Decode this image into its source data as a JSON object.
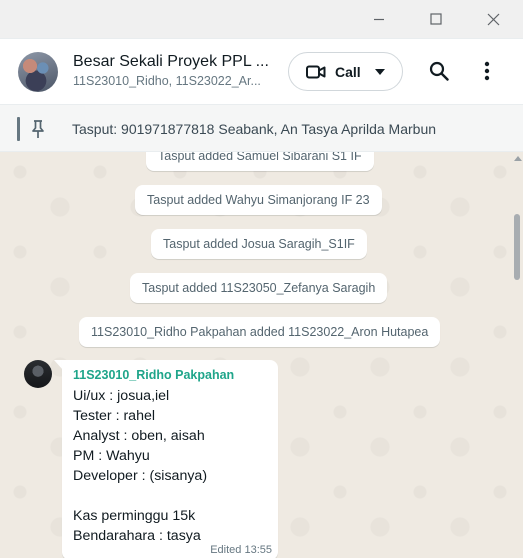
{
  "header": {
    "title": "Besar Sekali Proyek PPL ...",
    "subtitle": "11S23010_Ridho, 11S23022_Ar...",
    "call_label": "Call"
  },
  "pinned": {
    "sender": "Tasput",
    "text": ": 901971877818 Seabank, An Tasya Aprilda Marbun"
  },
  "system_messages": [
    "Tasput added Samuel Sibarani S1 IF",
    "Tasput added Wahyu Simanjorang IF 23",
    "Tasput added Josua Saragih_S1IF",
    "Tasput added 11S23050_Zefanya Saragih",
    "11S23010_Ridho Pakpahan added 11S23022_Aron Hutapea"
  ],
  "message": {
    "sender": "11S23010_Ridho Pakpahan",
    "lines": [
      "Ui/ux : josua,iel",
      "Tester : rahel",
      "Analyst : oben, aisah",
      "PM : Wahyu",
      "Developer : (sisanya)",
      "",
      "Kas perminggu 15k",
      "Bendarahara : tasya"
    ],
    "meta": "Edited 13:55"
  },
  "icons": {
    "minimize": "minimize-icon",
    "maximize": "maximize-icon",
    "close": "close-icon",
    "video": "video-icon",
    "caret": "chevron-down-icon",
    "search": "search-icon",
    "menu": "more-vertical-icon",
    "pin": "pin-icon"
  },
  "colors": {
    "chat_background": "#efeae2",
    "sender_name": "#1fa58a",
    "bubble": "#ffffff"
  }
}
